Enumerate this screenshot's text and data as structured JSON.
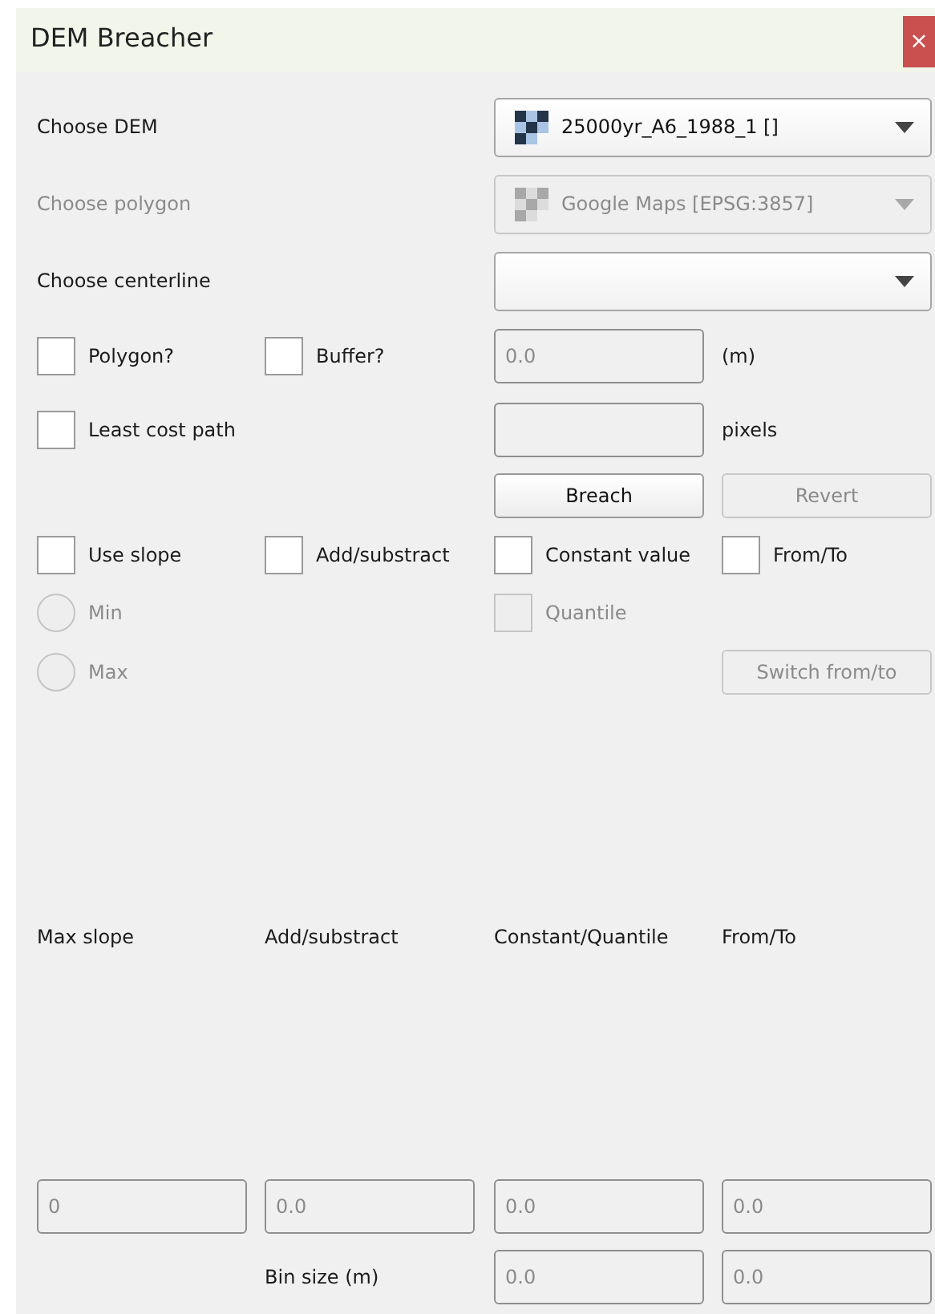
{
  "window": {
    "title": "DEM Breacher",
    "close": "×"
  },
  "combos": [
    {
      "label": "Choose DEM",
      "value": "25000yr_A6_1988_1 []",
      "disabled": false
    },
    {
      "label": "Choose polygon",
      "value": "Google Maps [EPSG:3857]",
      "disabled": true
    },
    {
      "label": "Choose centerline",
      "disabled": false
    }
  ],
  "polygon": {
    "label": "Polygon?",
    "checked": false,
    "disabled": false
  },
  "buffer": {
    "label": "Buffer?",
    "checked": false,
    "disabled": false
  },
  "buffer_size": {
    "placeholder": "0.0"
  },
  "buffer_unit": "(m)",
  "least_cost_path": {
    "label": "Least cost path",
    "checked": false,
    "disabled": false
  },
  "pixels_unit": "pixels",
  "buttons": [
    {
      "label": "Breach",
      "disabled": false
    },
    {
      "label": "Revert",
      "disabled": true
    }
  ],
  "methods": [
    {
      "label": "Use slope",
      "checked": false,
      "disabled": false
    },
    {
      "label": "Add/substract",
      "checked": false,
      "disabled": false
    },
    {
      "label": "Constant value",
      "checked": false,
      "disabled": false
    },
    {
      "label": "From/To",
      "checked": false,
      "disabled": false
    }
  ],
  "slope_mode": [
    {
      "label": "Min",
      "selected": false,
      "disabled": true
    },
    {
      "label": "Max",
      "selected": false,
      "disabled": true
    }
  ],
  "quantile": {
    "label": "Quantile",
    "checked": false,
    "disabled": true
  },
  "switch_button": {
    "label": "Switch from/to",
    "disabled": true
  },
  "value_headers": [
    "Max slope",
    "Add/substract",
    "Constant/Quantile",
    "From/To"
  ],
  "value_fields": [
    {
      "placeholder": "0"
    },
    {
      "placeholder": "0.0"
    },
    {
      "placeholder": "0.0"
    },
    {
      "placeholder": "0.0"
    }
  ],
  "bin_size": {
    "label": "Bin size (m)",
    "fields": [
      {
        "placeholder": "0.0"
      },
      {
        "placeholder": "0.0"
      }
    ]
  }
}
